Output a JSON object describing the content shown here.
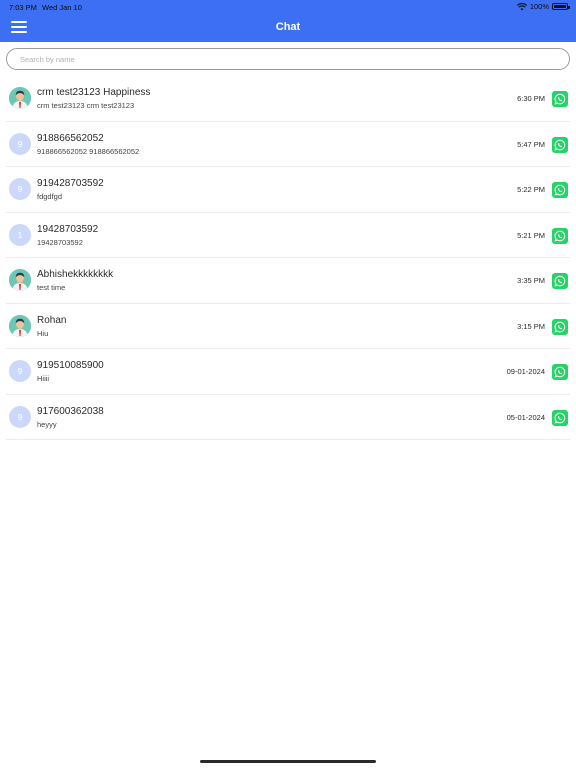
{
  "status_bar": {
    "time": "7:03 PM",
    "date": "Wed Jan 10",
    "battery": "100%"
  },
  "header": {
    "title": "Chat",
    "menu_icon": "hamburger-icon",
    "bg_color": "#3d6ff5"
  },
  "search": {
    "placeholder": "Search by name",
    "value": ""
  },
  "chats": [
    {
      "avatar_type": "photo",
      "initial": "",
      "name": "crm test23123 Happiness",
      "message": " crm test23123 crm test23123",
      "time": "6:30 PM"
    },
    {
      "avatar_type": "initial",
      "initial": "9",
      "name": "918866562052",
      "message": "918866562052 918866562052",
      "time": "5:47 PM"
    },
    {
      "avatar_type": "initial",
      "initial": "9",
      "name": "919428703592",
      "message": "fdgdfgd",
      "time": "5:22 PM"
    },
    {
      "avatar_type": "initial",
      "initial": "1",
      "name": "19428703592",
      "message": "19428703592",
      "time": "5:21 PM"
    },
    {
      "avatar_type": "photo",
      "initial": "",
      "name": " Abhishekkkkkkkk",
      "message": "test time",
      "time": "3:35 PM"
    },
    {
      "avatar_type": "photo",
      "initial": "",
      "name": " Rohan",
      "message": "Hiu",
      "time": "3:15 PM"
    },
    {
      "avatar_type": "initial",
      "initial": "9",
      "name": "919510085900",
      "message": "Hiiii",
      "time": "09-01-2024"
    },
    {
      "avatar_type": "initial",
      "initial": "9",
      "name": "917600362038",
      "message": "heyyy",
      "time": "05-01-2024"
    }
  ],
  "colors": {
    "accent": "#3d6ff5",
    "whatsapp": "#25d366",
    "avatar_initial_bg": "#cbd8fa"
  }
}
